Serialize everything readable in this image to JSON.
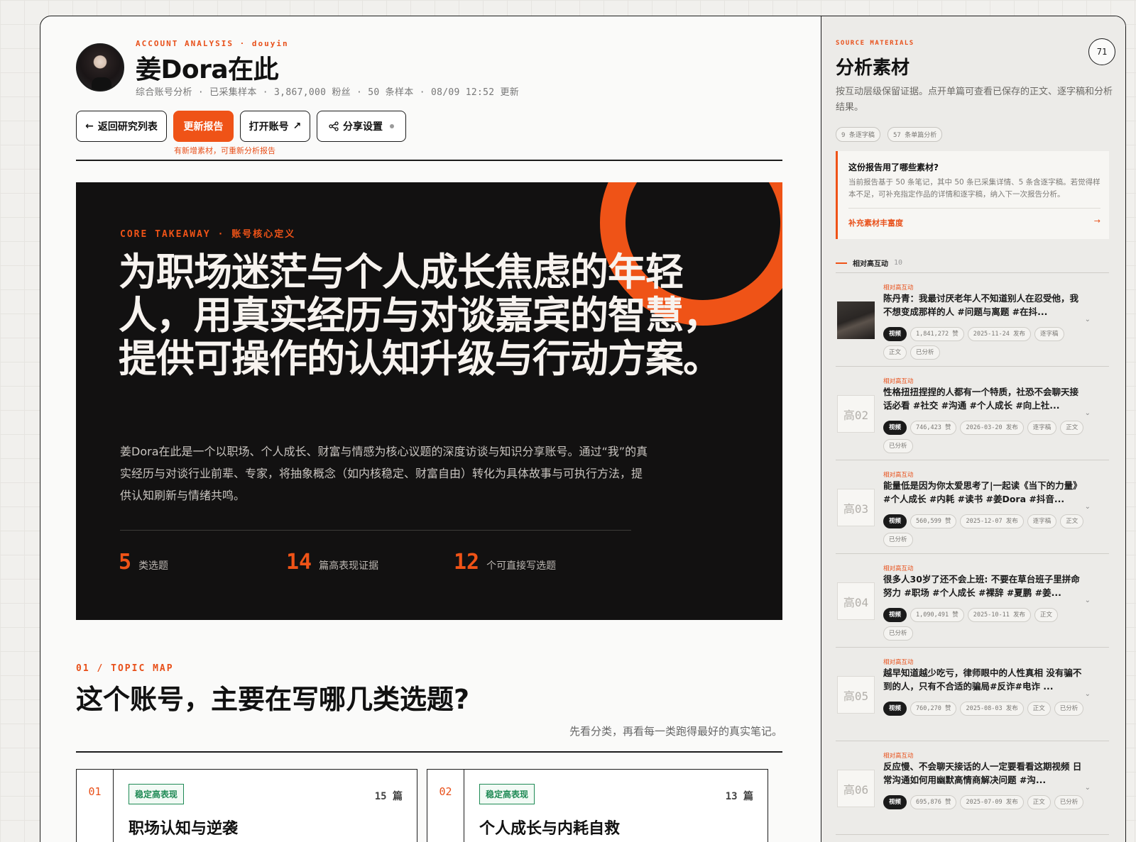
{
  "header": {
    "eyebrow": "ACCOUNT ANALYSIS · douyin",
    "title": "姜Dora在此",
    "meta": "综合账号分析 · 已采集样本 · 3,867,000 粉丝 · 50 条样本 · 08/09 12:52 更新",
    "buttons": {
      "back": "返回研究列表",
      "update": "更新报告",
      "open": "打开账号",
      "share": "分享设置"
    },
    "hint": "有新增素材，可重新分析报告"
  },
  "hero": {
    "eyebrow": "CORE TAKEAWAY · 账号核心定义",
    "title": "为职场迷茫与个人成长焦虑的年轻人，用真实经历与对谈嘉宾的智慧，提供可操作的认知升级与行动方案。",
    "description": "姜Dora在此是一个以职场、个人成长、财富与情感为核心议题的深度访谈与知识分享账号。通过“我”的真实经历与对谈行业前辈、专家，将抽象概念（如内核稳定、财富自由）转化为具体故事与可执行方法，提供认知刷新与情绪共鸣。",
    "stats": [
      {
        "num": "5",
        "label": "类选题"
      },
      {
        "num": "14",
        "label": "篇高表现证据"
      },
      {
        "num": "12",
        "label": "个可直接写选题"
      }
    ]
  },
  "topic_section": {
    "eyebrow": "01 / TOPIC MAP",
    "title": "这个账号，主要在写哪几类选题?",
    "note": "先看分类，再看每一类跑得最好的真实笔记。",
    "cards": [
      {
        "idx": "01",
        "tag": "稳定高表现",
        "count": "15 篇",
        "title": "职场认知与逆袭"
      },
      {
        "idx": "02",
        "tag": "稳定高表现",
        "count": "13 篇",
        "title": "个人成长与内耗自救"
      }
    ]
  },
  "sidebar": {
    "eyebrow": "SOURCE MATERIALS",
    "title": "分析素材",
    "count": "71",
    "description": "按互动层级保留证据。点开单篇可查看已保存的正文、逐字稿和分析结果。",
    "pills": [
      "9 条逐字稿",
      "57 条单篇分析"
    ],
    "callout": {
      "title": "这份报告用了哪些素材?",
      "description": "当前报告基于 50 条笔记，其中 50 条已采集详情、5 条含逐字稿。若觉得样本不足，可补充指定作品的详情和逐字稿，纳入下一次报告分析。",
      "link": "补充素材丰富度",
      "arrow": "→"
    },
    "group": {
      "label": "相对高互动",
      "count": "10"
    },
    "items": [
      {
        "thumb": "",
        "label": "相对高互动",
        "title": "陈丹青：我最讨厌老年人不知道别人在忍受他，我不想变成那样的人 #问题与离题 #在抖...",
        "tags": [
          "视频",
          "1,841,272 赞",
          "2025-11-24 发布",
          "逐字稿",
          "正文",
          "已分析"
        ]
      },
      {
        "thumb": "高02",
        "label": "相对高互动",
        "title": "性格扭扭捏捏的人都有一个特质，社恐不会聊天接话必看 #社交 #沟通 #个人成长 #向上社...",
        "tags": [
          "视频",
          "746,423 赞",
          "2026-03-20 发布",
          "逐字稿",
          "正文",
          "已分析"
        ]
      },
      {
        "thumb": "高03",
        "label": "相对高互动",
        "title": "能量低是因为你太爱思考了|一起读《当下的力量》 #个人成长 #内耗 #读书 #姜Dora #抖音...",
        "tags": [
          "视频",
          "560,599 赞",
          "2025-12-07 发布",
          "逐字稿",
          "正文",
          "已分析"
        ]
      },
      {
        "thumb": "高04",
        "label": "相对高互动",
        "title": "很多人30岁了还不会上班: 不要在草台班子里拼命努力 #职场 #个人成长 #裸辞 #夏鹏 #姜...",
        "tags": [
          "视频",
          "1,090,491 赞",
          "2025-10-11 发布",
          "正文",
          "已分析"
        ]
      },
      {
        "thumb": "高05",
        "label": "相对高互动",
        "title": "越早知道越少吃亏，律师眼中的人性真相 没有骗不到的人，只有不合适的骗局#反诈#电诈 ...",
        "tags": [
          "视频",
          "760,270 赞",
          "2025-08-03 发布",
          "正文",
          "已分析"
        ]
      },
      {
        "thumb": "高06",
        "label": "相对高互动",
        "title": "反应慢、不会聊天接话的人一定要看看这期视频 日常沟通如何用幽默高情商解决问题 #沟...",
        "tags": [
          "视频",
          "695,876 赞",
          "2025-07-09 发布",
          "正文",
          "已分析"
        ]
      }
    ]
  },
  "colors": {
    "accent": "#ef5317",
    "hero_bg": "#121111",
    "tag_green": "#1f8a55"
  }
}
